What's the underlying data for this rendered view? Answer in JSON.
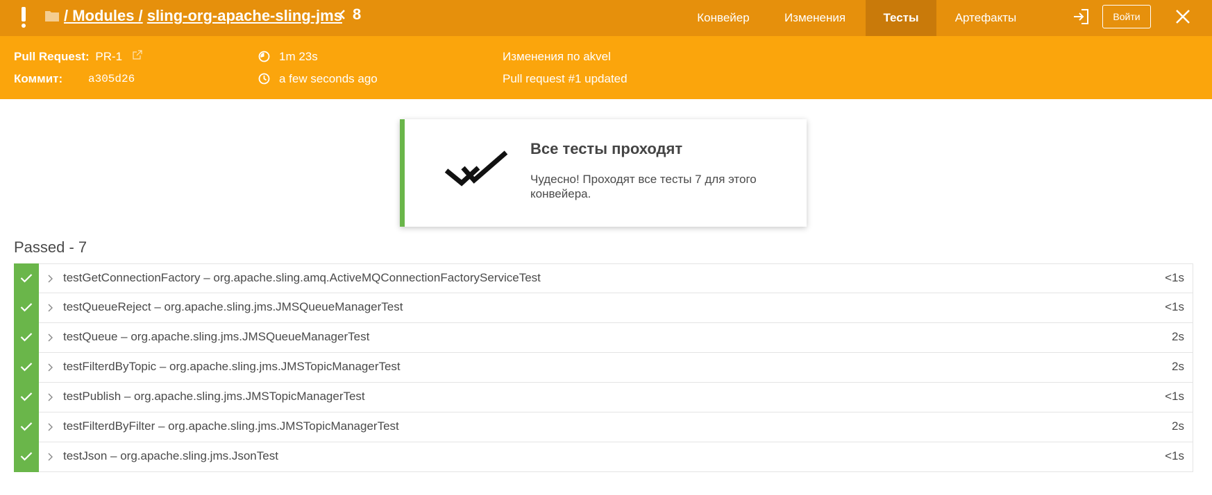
{
  "header": {
    "breadcrumb_prefix": "/ Modules /",
    "breadcrumb_link": "sling-org-apache-sling-jms",
    "run_number": "8",
    "tabs": [
      {
        "label": "Конвейер"
      },
      {
        "label": "Изменения"
      },
      {
        "label": "Тесты"
      },
      {
        "label": "Артефакты"
      }
    ],
    "login_label": "Войти"
  },
  "info": {
    "pr_label": "Pull Request:",
    "pr_value": "PR-1",
    "commit_label": "Коммит:",
    "commit_value": "a305d26",
    "duration": "1m 23s",
    "time_ago": "a few seconds ago",
    "changes_by": "Изменения по akvel",
    "cause": "Pull request #1 updated"
  },
  "summary": {
    "title": "Все тесты проходят",
    "text": "Чудесно! Проходят все тесты 7 для этого конвейера."
  },
  "passed": {
    "heading": "Passed - 7",
    "tests": [
      {
        "name": "testGetConnectionFactory – org.apache.sling.amq.ActiveMQConnectionFactoryServiceTest",
        "duration": "<1s"
      },
      {
        "name": "testQueueReject – org.apache.sling.jms.JMSQueueManagerTest",
        "duration": "<1s"
      },
      {
        "name": "testQueue – org.apache.sling.jms.JMSQueueManagerTest",
        "duration": "2s"
      },
      {
        "name": "testFilterdByTopic – org.apache.sling.jms.JMSTopicManagerTest",
        "duration": "2s"
      },
      {
        "name": "testPublish – org.apache.sling.jms.JMSTopicManagerTest",
        "duration": "<1s"
      },
      {
        "name": "testFilterdByFilter – org.apache.sling.jms.JMSTopicManagerTest",
        "duration": "2s"
      },
      {
        "name": "testJson – org.apache.sling.jms.JsonTest",
        "duration": "<1s"
      }
    ]
  },
  "colors": {
    "topbar": "#e6900c",
    "infobar": "#fba50c",
    "active_tab": "#c97a0a",
    "success": "#6ab64a"
  }
}
